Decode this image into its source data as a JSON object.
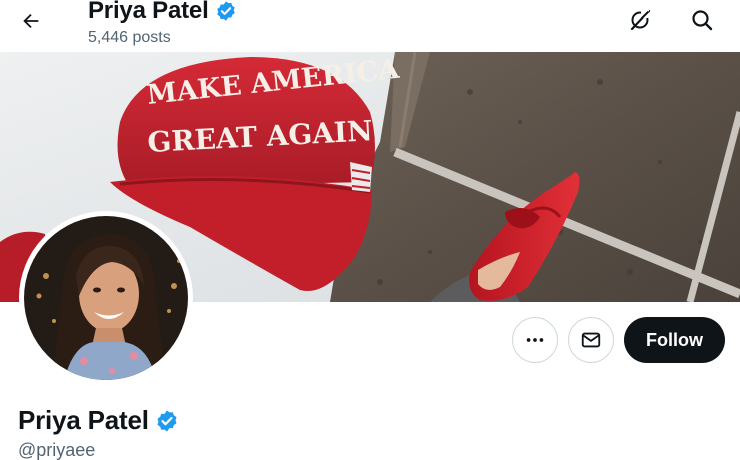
{
  "header": {
    "name": "Priya Patel",
    "posts_count": "5,446 posts",
    "icons": [
      "back-arrow-icon",
      "verified-badge-icon",
      "grok-icon",
      "search-icon"
    ]
  },
  "banner": {
    "hat_text_line1": "MAKE AMERICA",
    "hat_text_line2": "GREAT AGAIN",
    "hat_color": "#c8232f",
    "shoe_color": "#d0202b"
  },
  "profile": {
    "name": "Priya Patel",
    "handle": "@priyaee",
    "verified_color": "#1d9bf0"
  },
  "actions": {
    "more_icon": "more-icon",
    "message_icon": "mail-icon",
    "follow_label": "Follow"
  }
}
